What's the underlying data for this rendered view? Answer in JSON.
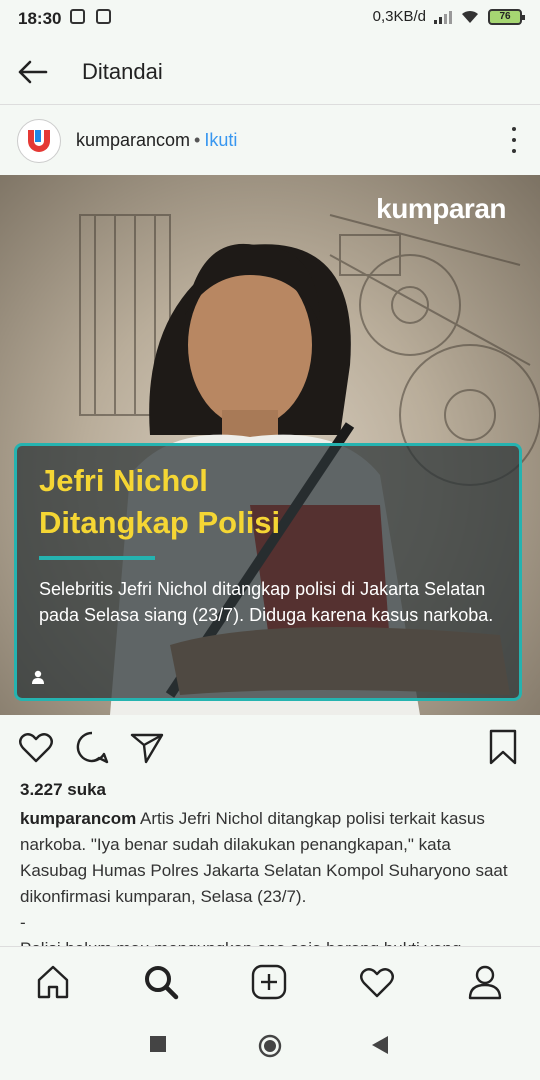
{
  "status_bar": {
    "time": "18:30",
    "network_speed": "0,3KB/d",
    "battery": "76"
  },
  "header": {
    "title": "Ditandai"
  },
  "post": {
    "username": "kumparancom",
    "separator": "•",
    "follow_label": "Ikuti",
    "image": {
      "brand": "kumparan",
      "headline_line1": "Jefri Nichol",
      "headline_line2": "Ditangkap Polisi",
      "description": "Selebritis Jefri Nichol ditangkap polisi di Jakarta Selatan pada Selasa siang (23/7). Diduga karena kasus narkoba."
    },
    "likes": "3.227 suka",
    "caption_user": "kumparancom",
    "caption_text": "Artis Jefri Nichol ditangkap polisi terkait kasus narkoba. \"Iya benar sudah dilakukan penangkapan,\" kata Kasubag Humas Polres Jakarta Selatan Kompol Suharyono saat dikonfirmasi kumparan, Selasa (23/7).",
    "caption_dash": "-",
    "caption_more": "Polisi belum mau mengungkap apa saja barang bukti yang"
  },
  "colors": {
    "accent_teal": "#25b3b0",
    "headline_yellow": "#f5d634",
    "link_blue": "#3897f0"
  },
  "icons": [
    "back-arrow-icon",
    "more-vert-icon",
    "heart-icon",
    "comment-icon",
    "share-icon",
    "bookmark-icon",
    "home-icon",
    "search-icon",
    "add-post-icon",
    "activity-heart-icon",
    "profile-icon"
  ]
}
